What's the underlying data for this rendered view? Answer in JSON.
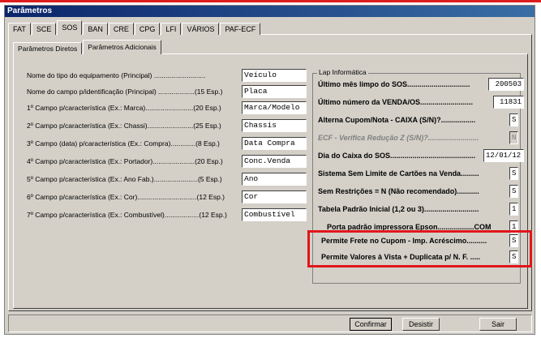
{
  "window": {
    "title": "Parâmetros"
  },
  "top_tabs": [
    "FAT",
    "SCE",
    "SOS",
    "BAN",
    "CRE",
    "CPG",
    "LFI",
    "VÁRIOS",
    "PAF-ECF"
  ],
  "active_top_tab": "SOS",
  "sub_tabs": [
    "Parâmetros Diretos",
    "Parâmetros Adicionais"
  ],
  "active_sub_tab": "Parâmetros Adicionais",
  "left_fields": [
    {
      "label": "Nome do tipo do equipamento (Principal) ...........................",
      "value": "Veículo"
    },
    {
      "label": "Nome do campo p/identificação (Principal) ...................(15 Esp.)",
      "value": "Placa"
    },
    {
      "label": "1º Campo p/característica (Ex.: Marca).........................(20 Esp.)",
      "value": "Marca/Modelo"
    },
    {
      "label": "2º Campo p/característica (Ex.: Chassi)........................(25 Esp.)",
      "value": "Chassis"
    },
    {
      "label": "3º Campo (data) p/característica (Ex.: Compra).............(8 Esp.)",
      "value": "Data Compra"
    },
    {
      "label": "4º Campo p/característica (Ex.: Portador)......................(20 Esp.)",
      "value": "Conc.Venda"
    },
    {
      "label": "5º Campo p/característica (Ex.: Ano Fab.).......................(5 Esp.)",
      "value": "Ano"
    },
    {
      "label": "6º Campo p/característica (Ex.: Cor)...............................(12 Esp.)",
      "value": "Cor"
    },
    {
      "label": "7º Campo p/característica (Ex.: Combustível)..................(12 Esp.)",
      "value": "Combustível"
    }
  ],
  "groupbox": {
    "title": "Lap Informática",
    "rows": [
      {
        "label": "Último mês limpo do SOS...............................",
        "value": "200503"
      },
      {
        "label": "Último número da VENDA/OS..........................",
        "value": "11831"
      },
      {
        "label": "Alterna Cupom/Nota - CAIXA (S/N)?.................",
        "value": "S"
      },
      {
        "label": "ECF - Verifica Redução Z (S/N)?.........................",
        "value": "N"
      },
      {
        "label": "Dia do Caixa do SOS..........................................",
        "value": "12/01/12"
      },
      {
        "label": "Sistema Sem Limite de Cartões na Venda.........",
        "value": "S"
      },
      {
        "label": "Sem Restrições = N (Não recomendado)...........",
        "value": "S"
      },
      {
        "label": "Tabela Padrão Inicial (1,2 ou 3)...........................",
        "value": "1"
      },
      {
        "label": "Porta padrão impressora Epson..................COM",
        "value": "1"
      },
      {
        "label": "Permite Frete no Cupom - Imp. Acréscimo..........",
        "value": "S"
      },
      {
        "label": "Permite Valores à Vista + Duplicata p/ N. F. .....",
        "value": "S"
      }
    ]
  },
  "buttons": {
    "confirm": "Confirmar",
    "cancel": "Desistir",
    "exit": "Sair"
  },
  "colors": {
    "window_bg": "#d4d0c8",
    "title_bar": "#0a246a",
    "highlight": "#e0161c"
  }
}
